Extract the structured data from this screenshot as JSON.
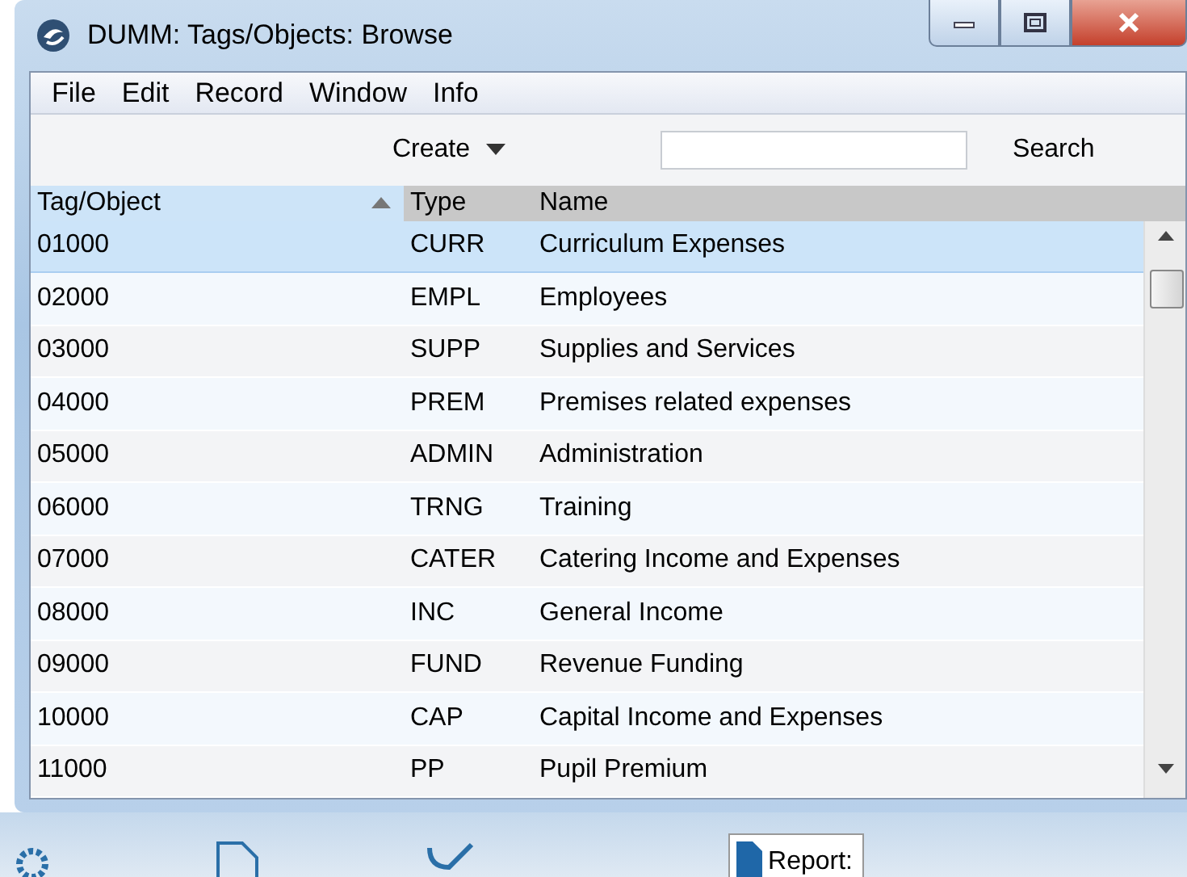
{
  "window": {
    "title": "DUMM: Tags/Objects: Browse"
  },
  "menu": [
    "File",
    "Edit",
    "Record",
    "Window",
    "Info"
  ],
  "toolbar": {
    "create": "Create",
    "search": "Search"
  },
  "table": {
    "columns": [
      {
        "label": "Tag/Object",
        "sorted": true
      },
      {
        "label": "Type",
        "sorted": false
      },
      {
        "label": "Name",
        "sorted": false
      }
    ],
    "rows": [
      {
        "cells": [
          "01000",
          "CURR",
          "Curriculum Expenses"
        ],
        "selected": true
      },
      {
        "cells": [
          "02000",
          "EMPL",
          "Employees"
        ],
        "selected": false
      },
      {
        "cells": [
          "03000",
          "SUPP",
          "Supplies and Services"
        ],
        "selected": false
      },
      {
        "cells": [
          "04000",
          "PREM",
          "Premises related expenses"
        ],
        "selected": false
      },
      {
        "cells": [
          "05000",
          "ADMIN",
          "Administration"
        ],
        "selected": false
      },
      {
        "cells": [
          "06000",
          "TRNG",
          "Training"
        ],
        "selected": false
      },
      {
        "cells": [
          "07000",
          "CATER",
          "Catering Income and Expenses"
        ],
        "selected": false
      },
      {
        "cells": [
          "08000",
          "INC",
          "General Income"
        ],
        "selected": false
      },
      {
        "cells": [
          "09000",
          "FUND",
          "Revenue Funding"
        ],
        "selected": false
      },
      {
        "cells": [
          "10000",
          "CAP",
          "Capital Income and Expenses"
        ],
        "selected": false
      },
      {
        "cells": [
          "11000",
          "PP",
          "Pupil Premium"
        ],
        "selected": false
      }
    ]
  },
  "taskbar": {
    "report": "Report:"
  }
}
